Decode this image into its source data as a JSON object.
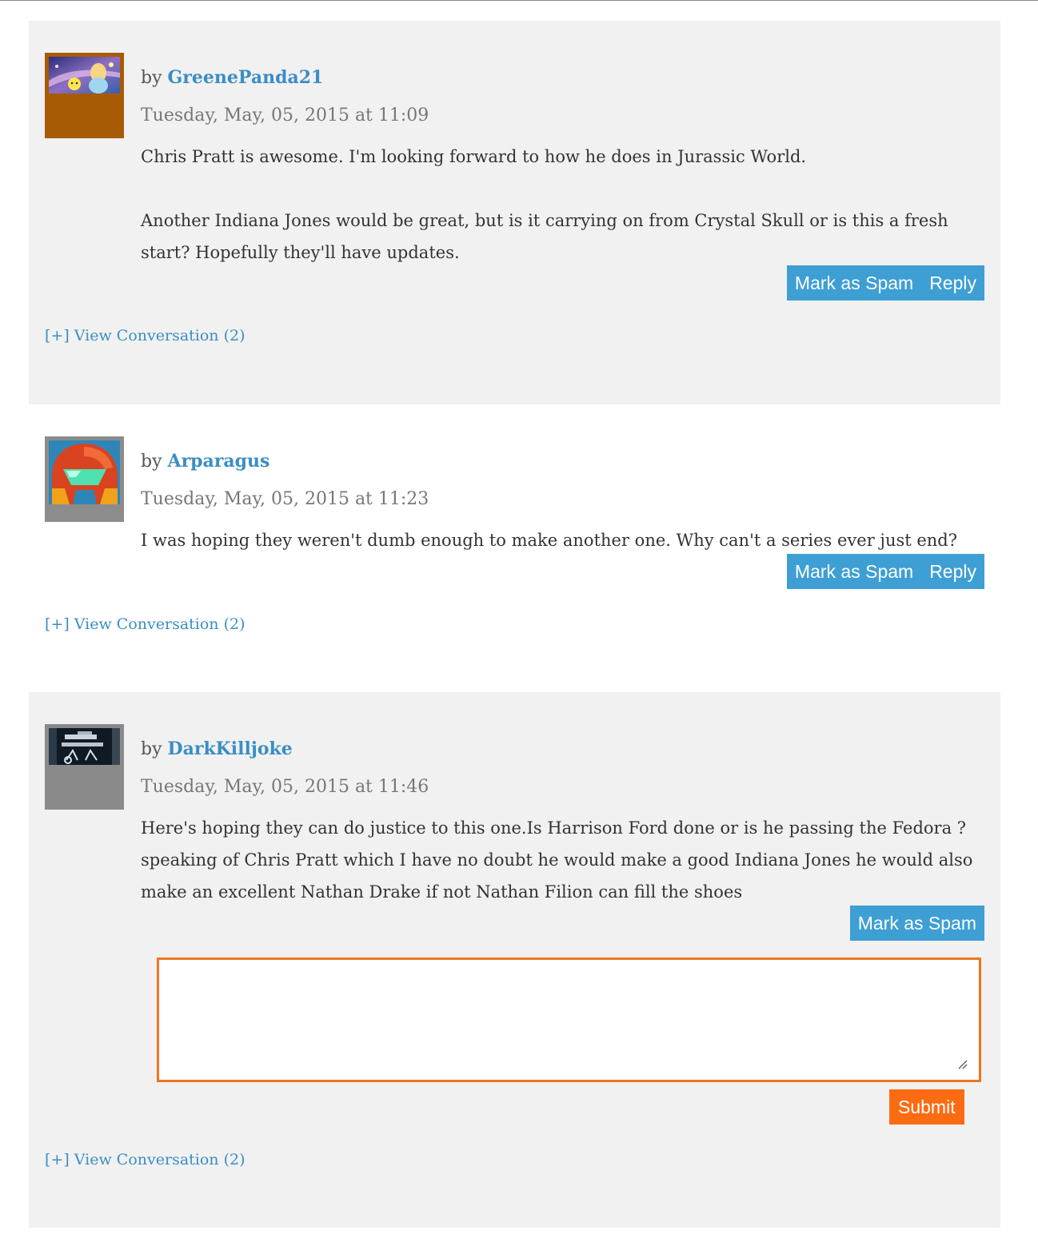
{
  "comments": [
    {
      "by_prefix": "by ",
      "author": "GreenePanda21",
      "date": "Tuesday, May, 05, 2015 at 11:09",
      "paragraphs": [
        "Chris Pratt is awesome. I'm looking forward to how he does in Jurassic World.",
        "Another Indiana Jones would be great, but is it carrying on from Crystal Skull or is this a fresh start? Hopefully they'll have updates."
      ],
      "spam_label": "Mark as Spam",
      "reply_label": "Reply",
      "view_conversation": "[+] View Conversation (2)"
    },
    {
      "by_prefix": "by ",
      "author": "Arparagus",
      "date": "Tuesday, May, 05, 2015 at 11:23",
      "paragraphs": [
        "I was hoping they weren't dumb enough to make another one. Why can't a series ever just end?"
      ],
      "spam_label": "Mark as Spam",
      "reply_label": "Reply",
      "view_conversation": "[+] View Conversation (2)"
    },
    {
      "by_prefix": "by ",
      "author": "DarkKilljoke",
      "date": "Tuesday, May, 05, 2015 at 11:46",
      "paragraphs": [
        "Here's hoping they can do justice to this one.Is Harrison Ford done or is he passing the Fedora ? speaking of Chris Pratt which I have no doubt he would make a good Indiana Jones he would also make an excellent Nathan Drake if not Nathan Filion can fill the shoes"
      ],
      "spam_label": "Mark as Spam",
      "view_conversation": "[+] View Conversation (2)"
    }
  ],
  "reply_form": {
    "value": "",
    "submit_label": "Submit"
  },
  "colors": {
    "link": "#3a8ec4",
    "action_bg": "#3e9fd4",
    "submit_bg": "#fb6c12",
    "textarea_border": "#f27420",
    "panel_bg": "#f1f1f1"
  }
}
